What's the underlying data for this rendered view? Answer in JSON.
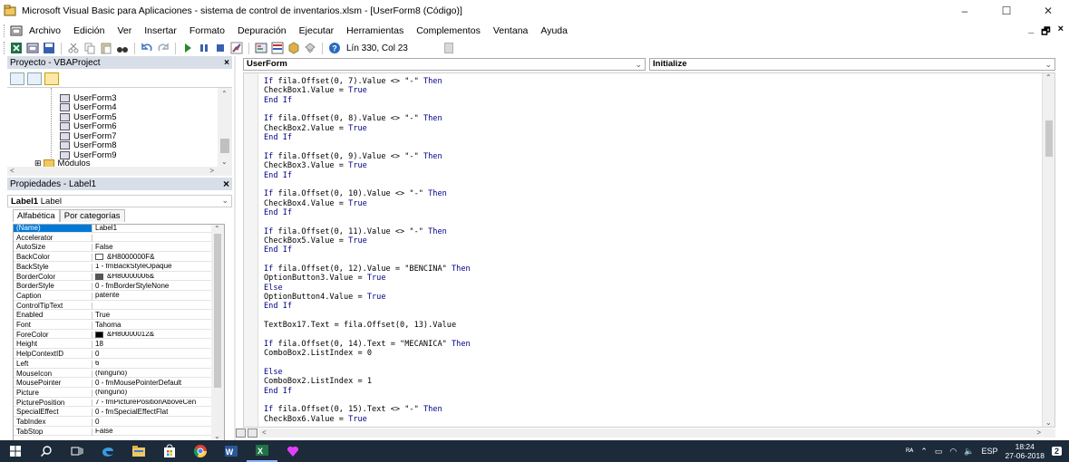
{
  "window": {
    "title": "Microsoft Visual Basic para Aplicaciones - sistema de control de inventarios.xlsm - [UserForm8 (Código)]",
    "minimize": "–",
    "maximize": "☐",
    "close": "✕",
    "mdi_min": "_",
    "mdi_restore": "🗗",
    "mdi_close": "×"
  },
  "menu": [
    "Archivo",
    "Edición",
    "Ver",
    "Insertar",
    "Formato",
    "Depuración",
    "Ejecutar",
    "Herramientas",
    "Complementos",
    "Ventana",
    "Ayuda"
  ],
  "toolbar": {
    "position": "Lín 330, Col 23",
    "icons": [
      "excel-icon",
      "insert-userform-icon",
      "save-icon",
      "cut-icon",
      "copy-icon",
      "paste-icon",
      "find-icon",
      "undo-icon",
      "redo-icon",
      "run-icon",
      "break-icon",
      "reset-icon",
      "design-mode-icon",
      "project-explorer-icon",
      "properties-icon",
      "object-browser-icon",
      "toolbox-icon",
      "help-icon"
    ]
  },
  "project": {
    "title": "Proyecto - VBAProject",
    "close": "×",
    "items": [
      "UserForm3",
      "UserForm4",
      "UserForm5",
      "UserForm6",
      "UserForm7",
      "UserForm8",
      "UserForm9"
    ],
    "modules": "Módulos",
    "expand": "⊞"
  },
  "properties": {
    "title": "Propiedades - Label1",
    "close": "×",
    "object_name": "Label1",
    "object_type": "Label",
    "tabs": [
      "Alfabética",
      "Por categorías"
    ],
    "rows": [
      {
        "name": "(Name)",
        "value": "Label1",
        "selected": true
      },
      {
        "name": "Accelerator",
        "value": ""
      },
      {
        "name": "AutoSize",
        "value": "False"
      },
      {
        "name": "BackColor",
        "value": "&H8000000F&",
        "swatch": "#ffffff"
      },
      {
        "name": "BackStyle",
        "value": "1 - fmBackStyleOpaque"
      },
      {
        "name": "BorderColor",
        "value": "&H80000006&",
        "swatch": "#555555"
      },
      {
        "name": "BorderStyle",
        "value": "0 - fmBorderStyleNone"
      },
      {
        "name": "Caption",
        "value": "patente"
      },
      {
        "name": "ControlTipText",
        "value": ""
      },
      {
        "name": "Enabled",
        "value": "True"
      },
      {
        "name": "Font",
        "value": "Tahoma"
      },
      {
        "name": "ForeColor",
        "value": "&H80000012&",
        "swatch": "#000000"
      },
      {
        "name": "Height",
        "value": "18"
      },
      {
        "name": "HelpContextID",
        "value": "0"
      },
      {
        "name": "Left",
        "value": "6"
      },
      {
        "name": "MouseIcon",
        "value": "(Ninguno)"
      },
      {
        "name": "MousePointer",
        "value": "0 - fmMousePointerDefault"
      },
      {
        "name": "Picture",
        "value": "(Ninguno)"
      },
      {
        "name": "PicturePosition",
        "value": "7 - fmPicturePositionAboveCen"
      },
      {
        "name": "SpecialEffect",
        "value": "0 - fmSpecialEffectFlat"
      },
      {
        "name": "TabIndex",
        "value": "0"
      },
      {
        "name": "TabStop",
        "value": "False"
      }
    ]
  },
  "code": {
    "object_combo": "UserForm",
    "procedure_combo": "Initialize",
    "lines": [
      [
        {
          "k": "If"
        },
        {
          "t": " fila.Offset(0, 7).Value <> \"-\" "
        },
        {
          "k": "Then"
        }
      ],
      [
        {
          "t": "CheckBox1.Value = "
        },
        {
          "k": "True"
        }
      ],
      [
        {
          "k": "End If"
        }
      ],
      [],
      [
        {
          "k": "If"
        },
        {
          "t": " fila.Offset(0, 8).Value <> \"-\" "
        },
        {
          "k": "Then"
        }
      ],
      [
        {
          "t": "CheckBox2.Value = "
        },
        {
          "k": "True"
        }
      ],
      [
        {
          "k": "End If"
        }
      ],
      [],
      [
        {
          "k": "If"
        },
        {
          "t": " fila.Offset(0, 9).Value <> \"-\" "
        },
        {
          "k": "Then"
        }
      ],
      [
        {
          "t": "CheckBox3.Value = "
        },
        {
          "k": "True"
        }
      ],
      [
        {
          "k": "End If"
        }
      ],
      [],
      [
        {
          "k": "If"
        },
        {
          "t": " fila.Offset(0, 10).Value <> \"-\" "
        },
        {
          "k": "Then"
        }
      ],
      [
        {
          "t": "CheckBox4.Value = "
        },
        {
          "k": "True"
        }
      ],
      [
        {
          "k": "End If"
        }
      ],
      [],
      [
        {
          "k": "If"
        },
        {
          "t": " fila.Offset(0, 11).Value <> \"-\" "
        },
        {
          "k": "Then"
        }
      ],
      [
        {
          "t": "CheckBox5.Value = "
        },
        {
          "k": "True"
        }
      ],
      [
        {
          "k": "End If"
        }
      ],
      [],
      [
        {
          "k": "If"
        },
        {
          "t": " fila.Offset(0, 12).Value = \"BENCINA\" "
        },
        {
          "k": "Then"
        }
      ],
      [
        {
          "t": "OptionButton3.Value = "
        },
        {
          "k": "True"
        }
      ],
      [
        {
          "k": "Else"
        }
      ],
      [
        {
          "t": "OptionButton4.Value = "
        },
        {
          "k": "True"
        }
      ],
      [
        {
          "k": "End If"
        }
      ],
      [],
      [
        {
          "t": "TextBox17.Text = fila.Offset(0, 13).Value"
        }
      ],
      [],
      [
        {
          "k": "If"
        },
        {
          "t": " fila.Offset(0, 14).Text = \"MECANICA\" "
        },
        {
          "k": "Then"
        }
      ],
      [
        {
          "t": "ComboBox2.ListIndex = 0"
        }
      ],
      [],
      [
        {
          "k": "Else"
        }
      ],
      [
        {
          "t": "ComboBox2.ListIndex = 1"
        }
      ],
      [
        {
          "k": "End If"
        }
      ],
      [],
      [
        {
          "k": "If"
        },
        {
          "t": " fila.Offset(0, 15).Text <> \"-\" "
        },
        {
          "k": "Then"
        }
      ],
      [
        {
          "t": "CheckBox6.Value = "
        },
        {
          "k": "True"
        }
      ]
    ]
  },
  "taskbar": {
    "tray_notify": "ᴿᴬ",
    "language": "ESP",
    "time": "18:24",
    "date": "27-06-2018",
    "notifications": "2"
  },
  "colors": {
    "keyword": "#00008b",
    "selection": "#0078d7",
    "taskbar": "#1c2a3a"
  }
}
